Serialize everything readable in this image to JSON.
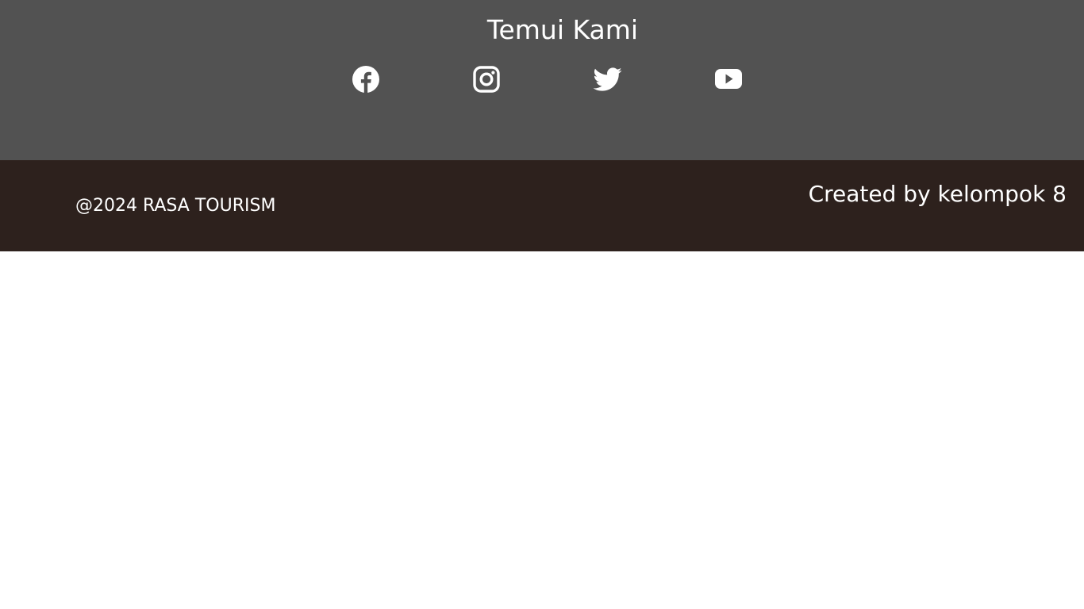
{
  "social": {
    "title": "Temui Kami",
    "links": [
      {
        "name": "facebook",
        "icon": "facebook-icon"
      },
      {
        "name": "instagram",
        "icon": "instagram-icon"
      },
      {
        "name": "twitter",
        "icon": "twitter-icon"
      },
      {
        "name": "youtube",
        "icon": "youtube-icon"
      }
    ],
    "background_color": "#525252",
    "icon_color": "#ffffff"
  },
  "footer": {
    "copyright": "@2024 RASA TOURISM",
    "credit": "Created by kelompok 8",
    "background_color": "#2d211d",
    "text_color": "#ffffff"
  }
}
